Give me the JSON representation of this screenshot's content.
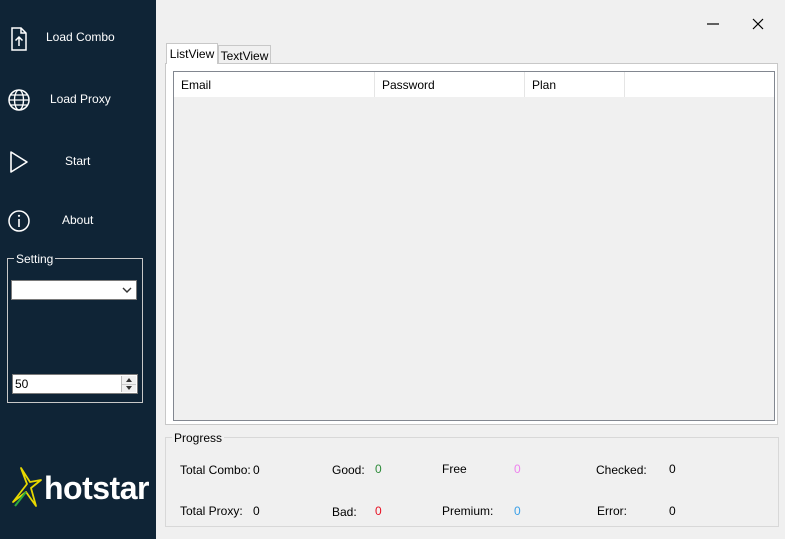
{
  "sidebar": {
    "load_combo": "Load Combo",
    "load_proxy": "Load Proxy",
    "start": "Start",
    "about": "About",
    "setting": {
      "legend": "Setting",
      "combo_value": "",
      "thread_value": "50"
    },
    "logo_text": "hotstar"
  },
  "tabs": [
    "ListView",
    "TextView"
  ],
  "listview": {
    "columns": [
      "Email",
      "Password",
      "Plan",
      ""
    ]
  },
  "progress": {
    "legend": "Progress",
    "total_combo_label": "Total Combo:",
    "total_combo": "0",
    "total_proxy_label": "Total Proxy:",
    "total_proxy": "0",
    "good_label": "Good:",
    "good": "0",
    "bad_label": "Bad:",
    "bad": "0",
    "free_label": "Free",
    "free": "0",
    "premium_label": "Premium:",
    "premium": "0",
    "checked_label": "Checked:",
    "checked": "0",
    "error_label": "Error:",
    "error": "0"
  },
  "colors": {
    "sidebar_bg": "#0f2436",
    "good": "#2e8b3a",
    "bad": "#e81123",
    "free": "#ee82ee",
    "premium": "#3aa0e8",
    "logo_star": "#e8d800"
  }
}
